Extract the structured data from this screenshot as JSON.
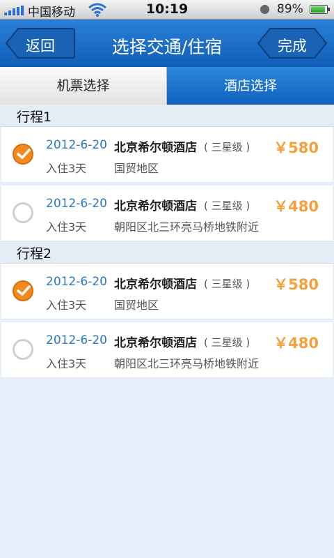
{
  "status_bar": {
    "carrier": "中国移动",
    "time": "10:19",
    "battery": "89%",
    "battery_level": 0.89
  },
  "nav": {
    "back_label": "返回",
    "title": "选择交通/住宿",
    "done_label": "完成"
  },
  "tabs": {
    "flight": "机票选择",
    "hotel": "酒店选择",
    "active": "hotel"
  },
  "itineraries": [
    {
      "title": "行程1",
      "options": [
        {
          "selected": true,
          "date": "2012-6-20",
          "hotel": "北京希尔顿酒店",
          "star": "( 三星级 )",
          "price": "￥580",
          "stay": "入住3天",
          "area": "国贸地区"
        },
        {
          "selected": false,
          "date": "2012-6-20",
          "hotel": "北京希尔顿酒店",
          "star": "( 三星级 )",
          "price": "￥480",
          "stay": "入住3天",
          "area": "朝阳区北三环亮马桥地铁附近"
        }
      ]
    },
    {
      "title": "行程2",
      "options": [
        {
          "selected": true,
          "date": "2012-6-20",
          "hotel": "北京希尔顿酒店",
          "star": "( 三星级 )",
          "price": "￥580",
          "stay": "入住3天",
          "area": "国贸地区"
        },
        {
          "selected": false,
          "date": "2012-6-20",
          "hotel": "北京希尔顿酒店",
          "star": "( 三星级 )",
          "price": "￥480",
          "stay": "入住3天",
          "area": "朝阳区北三环亮马桥地铁附近"
        }
      ]
    }
  ],
  "colors": {
    "nav_blue": "#1a6cc8",
    "date_blue": "#2b78c8",
    "price_orange": "#f2a13c",
    "check_orange": "#f28a1e",
    "background": "#e8f0fb"
  }
}
